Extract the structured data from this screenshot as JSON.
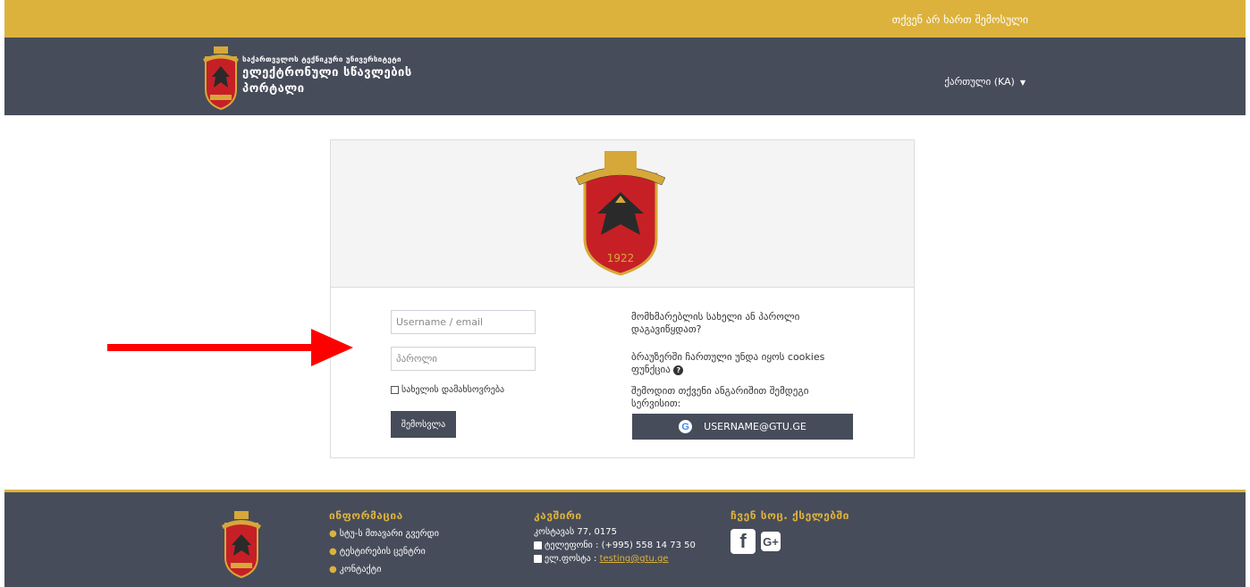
{
  "topbar": {
    "login_status": "თქვენ არ ხართ შემოსული"
  },
  "header": {
    "university_name": "საქართველოს ტექნიკური უნივერსიტეტი",
    "portal_line1": "ელექტრონული სწავლების",
    "portal_line2": "პორტალი",
    "language": "ქართული (KA)"
  },
  "logo": {
    "year": "1922",
    "icon": "gtu-eagle-emblem"
  },
  "login": {
    "username_placeholder": "Username / email",
    "password_placeholder": "პაროლი",
    "remember_label": "სახელის დამახსოვრება",
    "login_button": "შემოსვლა",
    "forgot_text": "მომხმარებლის სახელი ან პაროლი დაგავიწყდათ?",
    "cookies_text": "ბრაუზერში ჩართული უნდა იყოს cookies ფუნქცია",
    "oauth_text": "შემოდით თქვენი ანგარიშით შემდეგი სერვისით:",
    "oauth_button": "USERNAME@GTU.GE"
  },
  "footer": {
    "info_title": "ინფორმაცია",
    "info_items": [
      "სტუ-ს მთავარი გვერდი",
      "ტესტირების ცენტრი",
      "კონტაქტი"
    ],
    "contact_title": "კავშირი",
    "address": "კოსტავას 77, 0175",
    "phone": "ტელეფონი : (+995) 558 14 73 50",
    "email_label": "ელ.ფოსტა :",
    "email": "testing@gtu.ge",
    "social_title": "ჩვენ სოც. ქსელებში"
  },
  "colors": {
    "gold": "#dcb23c",
    "slate": "#474c5a",
    "arrow": "#ff0000"
  }
}
